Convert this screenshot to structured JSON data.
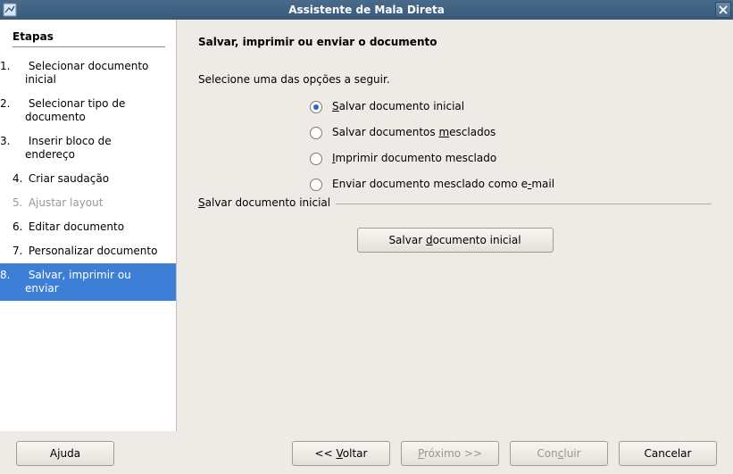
{
  "window": {
    "title": "Assistente de Mala Direta"
  },
  "sidebar": {
    "title": "Etapas",
    "steps": [
      {
        "num": "1.",
        "label": "Selecionar documento inicial",
        "state": "normal"
      },
      {
        "num": "2.",
        "label": "Selecionar tipo de documento",
        "state": "normal"
      },
      {
        "num": "3.",
        "label": "Inserir bloco de endereço",
        "state": "normal"
      },
      {
        "num": "4.",
        "label": "Criar saudação",
        "state": "normal"
      },
      {
        "num": "5.",
        "label": "Ajustar layout",
        "state": "disabled"
      },
      {
        "num": "6.",
        "label": "Editar documento",
        "state": "normal"
      },
      {
        "num": "7.",
        "label": "Personalizar documento",
        "state": "normal"
      },
      {
        "num": "8.",
        "label": "Salvar, imprimir ou enviar",
        "state": "active"
      }
    ]
  },
  "page": {
    "heading": "Salvar, imprimir ou enviar o documento",
    "intro": "Selecione uma das opções a seguir.",
    "options": [
      {
        "id": "opt-save-initial",
        "label": "Salvar documento inicial",
        "accesskey_index": 0,
        "checked": true
      },
      {
        "id": "opt-save-merged",
        "label": "Salvar documentos mesclados",
        "accesskey_index": 18,
        "checked": false
      },
      {
        "id": "opt-print-merged",
        "label": "Imprimir documento mesclado",
        "accesskey_index": 0,
        "checked": false
      },
      {
        "id": "opt-send-email",
        "label": "Enviar documento mesclado como e-mail",
        "accesskey_index": 32,
        "checked": false
      }
    ],
    "group_legend": "Salvar documento inicial",
    "group_legend_accesskey_index": 0,
    "save_button": "Salvar documento inicial",
    "save_button_accesskey_index": 7
  },
  "footer": {
    "help": "Ajuda",
    "help_accesskey_index": 1,
    "back": "<< Voltar",
    "back_accesskey_index": 3,
    "next": "Próximo >>",
    "next_accesskey_index": 0,
    "next_disabled": true,
    "finish": "Concluir",
    "finish_accesskey_index": 3,
    "finish_disabled": true,
    "cancel": "Cancelar"
  }
}
